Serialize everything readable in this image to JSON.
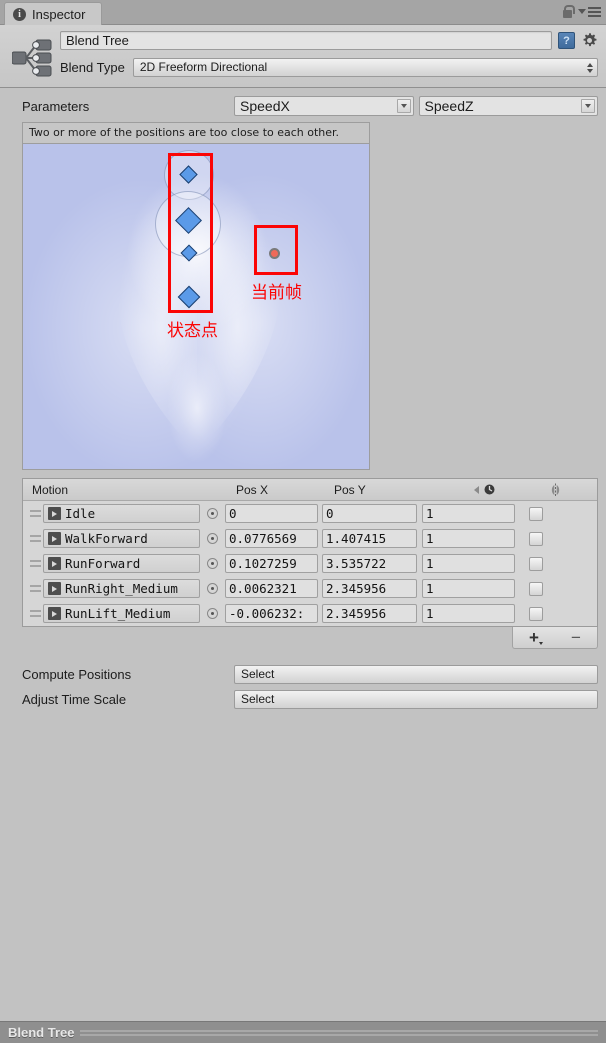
{
  "tab": {
    "label": "Inspector",
    "icon": "info-icon"
  },
  "titlebar_icons": {
    "lock": "lock-icon",
    "menu": "menu-icon"
  },
  "header": {
    "asset_icon": "blend-tree-icon",
    "name_value": "Blend Tree",
    "help_icon": "help-book-icon",
    "gear_icon": "gear-icon",
    "blend_type_label": "Blend Type",
    "blend_type_value": "2D Freeform Directional"
  },
  "parameters": {
    "label": "Parameters",
    "x_param": "SpeedX",
    "y_param": "SpeedZ"
  },
  "blend_field": {
    "warning": "Two or more of the positions are too close to each other.",
    "annotations": [
      {
        "name": "state-points",
        "text": "状态点"
      },
      {
        "name": "current-frame",
        "text": "当前帧"
      }
    ],
    "colors": {
      "field": "#b9c2ea",
      "marker": "#5b9ae8",
      "current": "#ef6a5a",
      "annotation": "#fb0505"
    }
  },
  "motion_table": {
    "headers": {
      "motion": "Motion",
      "pos_x": "Pos X",
      "pos_y": "Pos Y",
      "speed": "speed-icon",
      "mirror": "mirror-icon"
    },
    "rows": [
      {
        "motion": "Idle",
        "pos_x": "0",
        "pos_y": "0",
        "speed": "1",
        "mirror": false
      },
      {
        "motion": "WalkForward",
        "pos_x": "0.0776569",
        "pos_y": "1.407415",
        "speed": "1",
        "mirror": false
      },
      {
        "motion": "RunForward",
        "pos_x": "0.1027259",
        "pos_y": "3.535722",
        "speed": "1",
        "mirror": false
      },
      {
        "motion": "RunRight_Medium",
        "pos_x": "0.0062321",
        "pos_y": "2.345956",
        "speed": "1",
        "mirror": false
      },
      {
        "motion": "RunLift_Medium",
        "pos_x": "-0.006232:",
        "pos_y": "2.345956",
        "speed": "1",
        "mirror": false
      }
    ],
    "add_label": "+",
    "remove_label": "−"
  },
  "options": [
    {
      "label": "Compute Positions",
      "value": "Select"
    },
    {
      "label": "Adjust Time Scale",
      "value": "Select"
    }
  ],
  "status": {
    "text": "Blend Tree"
  }
}
